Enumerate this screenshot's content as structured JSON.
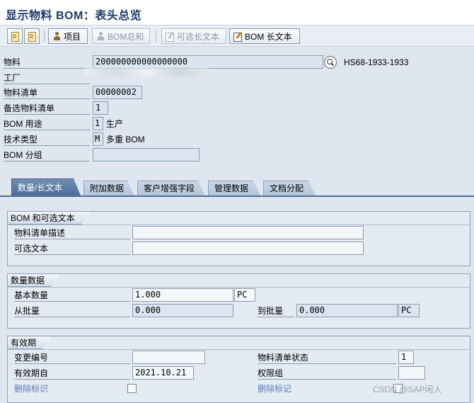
{
  "window": {
    "title": "显示物料 BOM：表头总览"
  },
  "toolbar": {
    "items_label": "项目",
    "bom_summary_label": "BOM总和",
    "alt_longtext_label": "可选长文本",
    "bom_longtext_label": "BOM 长文本"
  },
  "header": {
    "material_label": "物料",
    "material_value": "200000000000000000",
    "material_desc": "HS68-1933-1933",
    "plant_label": "工厂",
    "bom_label": "物料清单",
    "bom_value": "00000002",
    "alt_bom_label": "备选物料清单",
    "alt_bom_value": "1",
    "bom_usage_label": "BOM 用途",
    "bom_usage_value": "1",
    "bom_usage_text": "生产",
    "tech_type_label": "技术类型",
    "tech_type_value": "M",
    "tech_type_text": "多重 BOM",
    "bom_group_label": "BOM 分组",
    "bom_group_value": ""
  },
  "tabs": [
    {
      "label": "数量/长文本",
      "active": true
    },
    {
      "label": "附加数据",
      "active": false
    },
    {
      "label": "客户增强字段",
      "active": false
    },
    {
      "label": "管理数据",
      "active": false
    },
    {
      "label": "文档分配",
      "active": false
    }
  ],
  "group_text": {
    "title": "BOM 和可选文本",
    "bom_desc_label": "物料清单描述",
    "bom_desc_value": "",
    "alt_text_label": "可选文本",
    "alt_text_value": ""
  },
  "group_qty": {
    "title": "数量数据",
    "base_qty_label": "基本数量",
    "base_qty_value": "1.000",
    "base_qty_unit": "PC",
    "from_lot_label": "从批量",
    "from_lot_value": "0.000",
    "to_lot_label": "到批量",
    "to_lot_value": "0.000",
    "to_lot_unit": "PC"
  },
  "group_valid": {
    "title": "有效期",
    "change_no_label": "变更编号",
    "change_no_value": "",
    "bom_status_label": "物料清单状态",
    "bom_status_value": "1",
    "valid_from_label": "有效期自",
    "valid_from_value": "2021.10.21",
    "auth_group_label": "权限组",
    "auth_group_value": "",
    "delete_flag_label": "删除标识",
    "delete_mark_label": "删除标记"
  },
  "watermark": "CSDN @SAP闲人"
}
